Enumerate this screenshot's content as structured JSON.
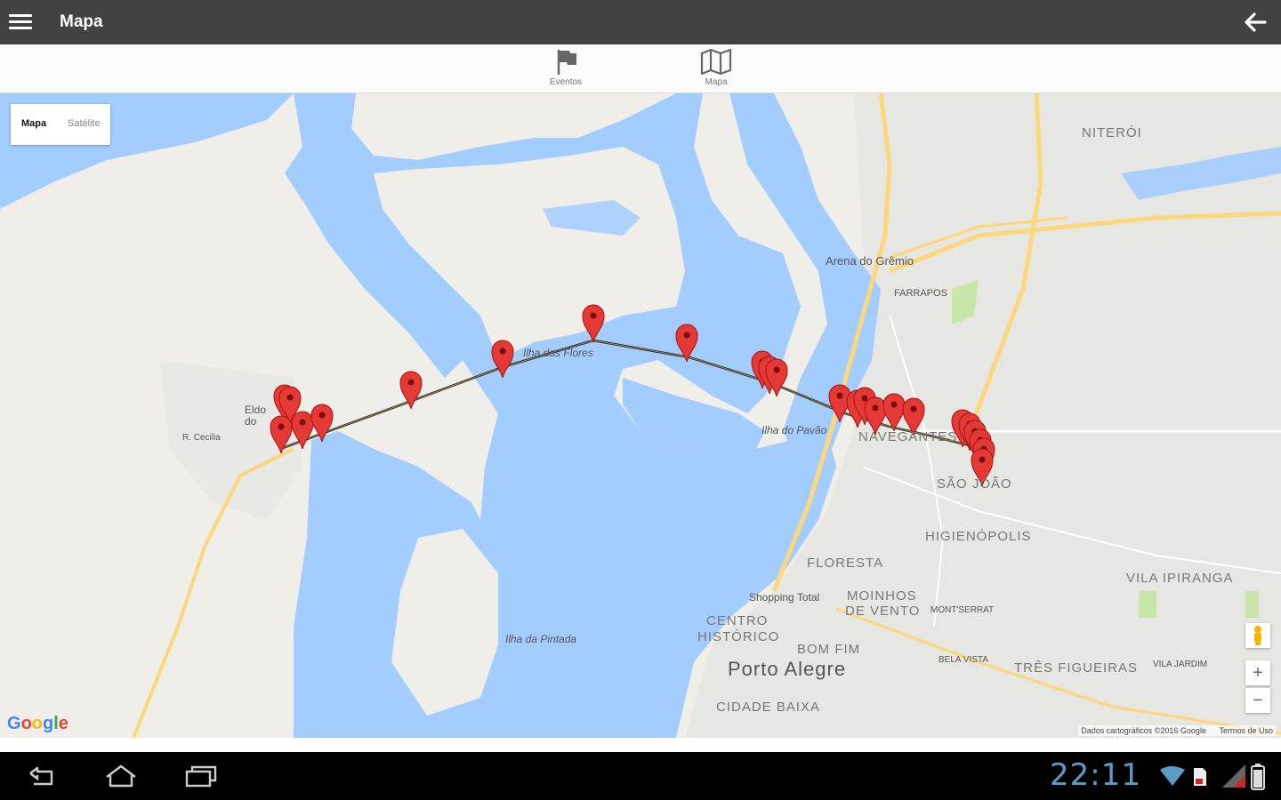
{
  "app": {
    "title": "Mapa"
  },
  "tabs": [
    {
      "label": "Eventos",
      "icon": "flag-icon"
    },
    {
      "label": "Mapa",
      "icon": "map-icon"
    }
  ],
  "map": {
    "type_control": {
      "map": "Mapa",
      "satellite": "Satélite"
    },
    "labels": {
      "niteroi": "NITERÓI",
      "arena": "Arena do Grêmio",
      "farrapos": "FARRAPOS",
      "ilha_flores": "Ilha das Flores",
      "ilha_pavao": "Ilha do Pavão",
      "navegantes": "NAVEGANTES",
      "sao_joao": "SÃO JOÃO",
      "higienopolis": "HIGIENÓPOLIS",
      "floresta": "FLORESTA",
      "vila_ipiranga": "VILA IPIRANGA",
      "shopping": "Shopping Total",
      "moinhos": "MOINHOS",
      "de_vento": "DE VENTO",
      "montserrat": "MONT'SERRAT",
      "centro": "CENTRO",
      "historico": "HISTÓRICO",
      "bom_fim": "BOM FIM",
      "porto_alegre": "Porto Alegre",
      "bela_vista": "BELA VISTA",
      "tres_figueiras": "TRÊS FIGUEIRAS",
      "vila_jardim": "VILA JARDIM",
      "cidade_baixa": "CIDADE BAIXA",
      "ilha_pintada": "Ilha da Pintada",
      "eldorado": "Eldo do",
      "cecilia": "R. Cecilia"
    },
    "zoom_in": "+",
    "zoom_out": "−",
    "logo": "Google",
    "attribution": "Dados cartográficos ©2016 Google",
    "terms": "Termos de Uso"
  },
  "status_bar": {
    "time": "22:11"
  },
  "colors": {
    "appbar": "#424242",
    "water": "#a3ccff",
    "road": "#fdd77c",
    "marker": "#e53935"
  }
}
